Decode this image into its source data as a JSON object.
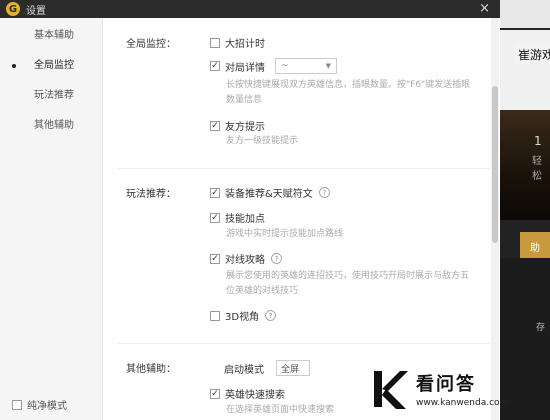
{
  "window": {
    "title": "设置",
    "logo_letter": "G",
    "close_glyph": "×"
  },
  "sidebar": {
    "items": [
      {
        "label": "基本辅助",
        "active": false
      },
      {
        "label": "全局监控",
        "active": true
      },
      {
        "label": "玩法推荐",
        "active": false
      },
      {
        "label": "其他辅助",
        "active": false
      }
    ],
    "pure_mode_label": "纯净模式"
  },
  "global_monitor": {
    "section_label": "全局监控：",
    "big_move_timer": {
      "label": "大招计时",
      "checked": false
    },
    "match_detail": {
      "label": "对局详情",
      "checked": true,
      "select_value": "~"
    },
    "match_detail_desc": "长按快捷键展现双方英雄信息，插眼数量。按\"F6\"键发送插眼数量信息",
    "friendly_hint": {
      "label": "友方提示",
      "checked": true
    },
    "friendly_hint_desc": "友方一级技能提示"
  },
  "play_recommend": {
    "section_label": "玩法推荐：",
    "equip_rune": {
      "label": "装备推荐&天赋符文",
      "checked": true
    },
    "skill_points": {
      "label": "技能加点",
      "checked": true
    },
    "skill_points_desc": "游戏中实时提示技能加点路线",
    "lane_strategy": {
      "label": "对线攻略",
      "checked": true
    },
    "lane_strategy_desc": "展示您使用的英雄的连招技巧，使用技巧开局时展示与敌方五位英雄的对线技巧",
    "view_3d": {
      "label": "3D视角",
      "checked": false
    }
  },
  "other_assist": {
    "section_label": "其他辅助：",
    "start_mode_label": "启动模式",
    "start_mode_value": "全屏",
    "hero_search": {
      "label": "英雄快速搜索",
      "checked": true
    },
    "hero_search_desc": "在选择英雄页面中快速搜索"
  },
  "background_app": {
    "title": "崔游戏",
    "number": "1",
    "sub": "轻松",
    "gold_btn": "助",
    "side_text": "存"
  },
  "watermark": {
    "cn": "看问答",
    "url": "www.kanwenda.com"
  },
  "colors": {
    "titlebar": "#2c2c2c",
    "logo": "#e6b422",
    "gold": "#c79a3e"
  }
}
